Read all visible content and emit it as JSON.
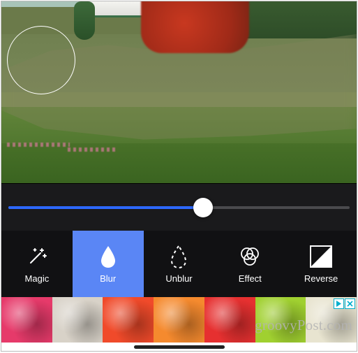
{
  "slider": {
    "value": 57
  },
  "tools": [
    {
      "id": "magic",
      "label": "Magic",
      "active": false
    },
    {
      "id": "blur",
      "label": "Blur",
      "active": true
    },
    {
      "id": "unblur",
      "label": "Unblur",
      "active": false
    },
    {
      "id": "effect",
      "label": "Effect",
      "active": false
    },
    {
      "id": "reverse",
      "label": "Reverse",
      "active": false
    }
  ],
  "ad": {
    "colors": [
      "#e63a6a",
      "#d8d2c8",
      "#f04a2a",
      "#f58a2e",
      "#e63030",
      "#a0d030",
      "#e8e4d0"
    ]
  },
  "watermark": "groovyPost.com",
  "colors": {
    "accent": "#2d68ff",
    "toolActive": "#5a86f5",
    "toolbarBg": "#111113",
    "sliderBg": "#1a1a1c"
  }
}
